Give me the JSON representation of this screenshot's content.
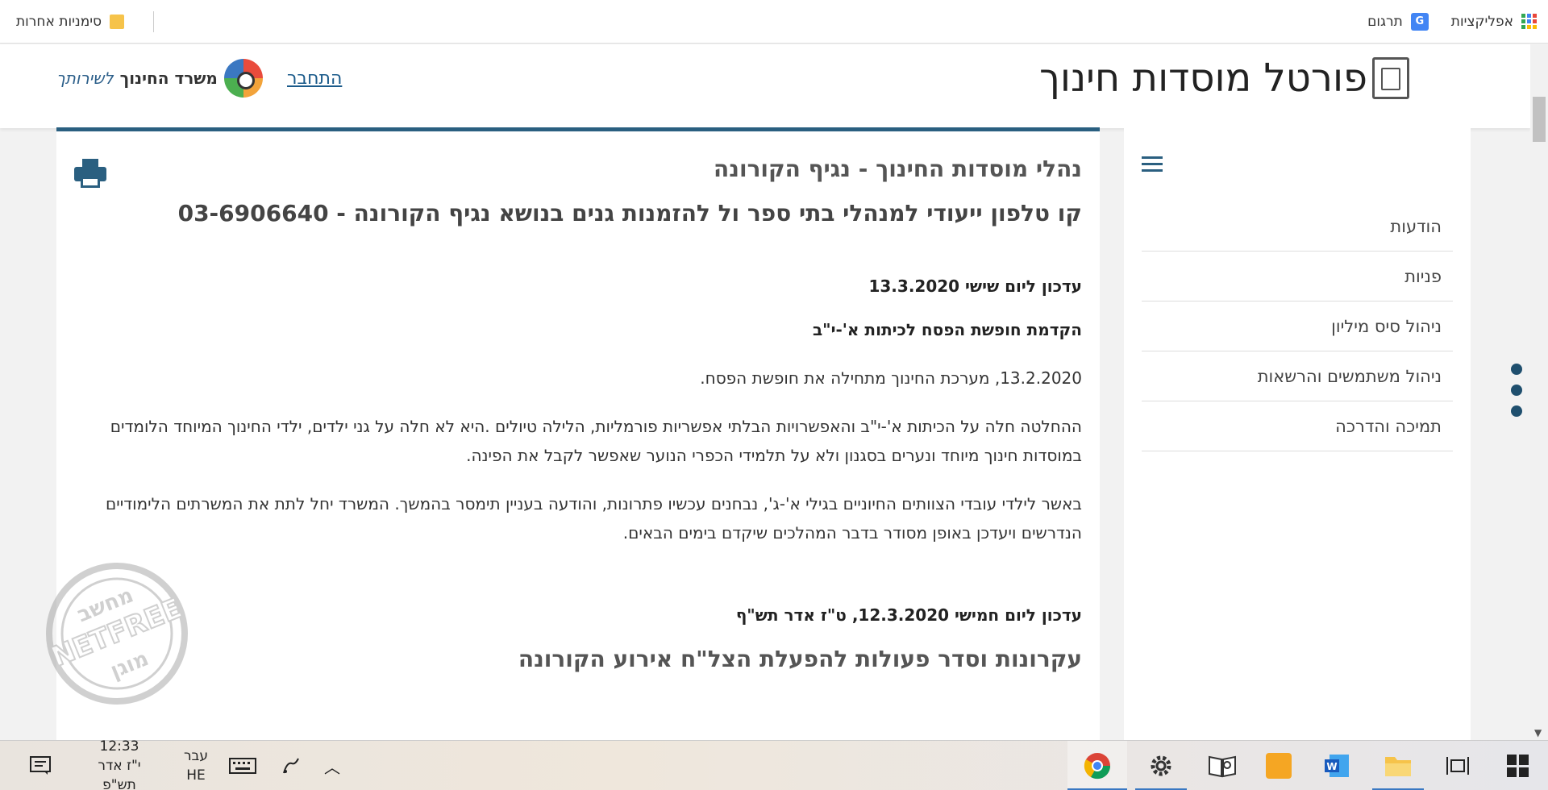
{
  "browser": {
    "bookmarks": {
      "apps_label": "אפליקציות",
      "translate_label": "תרגום",
      "translate_glyph": "G",
      "other_bookmarks": "סימניות אחרות"
    }
  },
  "header": {
    "site_title": "פורטל מוסדות חינוך",
    "login_link": "התחבר",
    "ministry_name": "משרד החינוך",
    "ministry_sub": "לשירותך"
  },
  "sidebar": {
    "menu": [
      {
        "label": "הודעות"
      },
      {
        "label": "פניות"
      },
      {
        "label": "ניהול סיס מיליון"
      },
      {
        "label": "ניהול משתמשים והרשאות"
      },
      {
        "label": "תמיכה והדרכה"
      }
    ]
  },
  "article": {
    "subtitle": "נהלי מוסדות החינוך - נגיף הקורונה",
    "title": "קו טלפון ייעודי למנהלי בתי ספר ול להזמנות גנים בנושא נגיף הקורונה - 03-6906640",
    "update1_heading": "עדכון ליום שישי 13.3.2020",
    "update1_subheading": "הקדמת חופשת הפסח לכיתות א'-י\"ב",
    "para1": "13.2.2020, מערכת החינוך מתחילה את חופשת הפסח.",
    "para2": "ההחלטה חלה על הכיתות א'-י\"ב והאפשרויות הבלתי אפשריות פורמליות, הלילה טיולים .היא לא חלה על גני ילדים, ילדי החינוך המיוחד הלומדים במוסדות חינוך מיוחד ונערים בסגנון ולא על תלמידי הכפרי הנוער שאפשר לקבל את הפינה.",
    "para3": "באשר לילדי עובדי הצוותים החיוניים בגילי א'-ג', נבחנים עכשיו פתרונות, והודעה בעניין תימסר בהמשך. המשרד יחל לתת את המשרתים הלימודיים הנדרשים ויעדכן באופן מסודר בדבר המהלכים שיקדם בימים הבאים.",
    "update2_heading": "עדכון ליום חמישי 12.3.2020, ט\"ז אדר תש\"ף",
    "section_title": "עקרונות וסדר פעולות להפעלת הצל\"ח אירוע הקורונה"
  },
  "watermark": {
    "top": "מחשב",
    "middle": "NETFREE",
    "bottom": "מוגן"
  },
  "taskbar": {
    "time": "12:33",
    "date": "י\"ז אדר תש\"פ",
    "lang_name": "עבר",
    "lang_code": "HE",
    "up_chevron": "︿"
  },
  "colors": {
    "accent": "#2a5f80",
    "link": "#1a5a8a"
  }
}
